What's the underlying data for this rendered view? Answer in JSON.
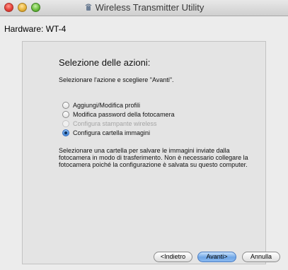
{
  "window": {
    "title": "Wireless Transmitter Utility",
    "app_icon": "wireless-transmitter-icon",
    "controls": [
      "close",
      "minimize",
      "zoom"
    ]
  },
  "hardware_label": "Hardware: WT-4",
  "panel": {
    "heading": "Selezione delle azioni:",
    "instruction": "Selezionare l'azione e scegliere \"Avanti\".",
    "options": [
      {
        "label": "Aggiungi/Modifica profili",
        "selected": false,
        "enabled": true
      },
      {
        "label": "Modifica password della fotocamera",
        "selected": false,
        "enabled": true
      },
      {
        "label": "Configura stampante wireless",
        "selected": false,
        "enabled": false
      },
      {
        "label": "Configura cartella immagini",
        "selected": true,
        "enabled": true
      }
    ],
    "description_lines": [
      "Selezionare una cartella per salvare le immagini inviate dalla",
      "fotocamera in modo di trasferimento. Non è necessario collegare la",
      "fotocamera poiché la configurazione è salvata su questo computer."
    ]
  },
  "buttons": {
    "back": "<Indietro",
    "next": "Avanti>",
    "cancel": "Annulla"
  },
  "colors": {
    "accent": "#3f86d9",
    "window_bg": "#ececec"
  }
}
